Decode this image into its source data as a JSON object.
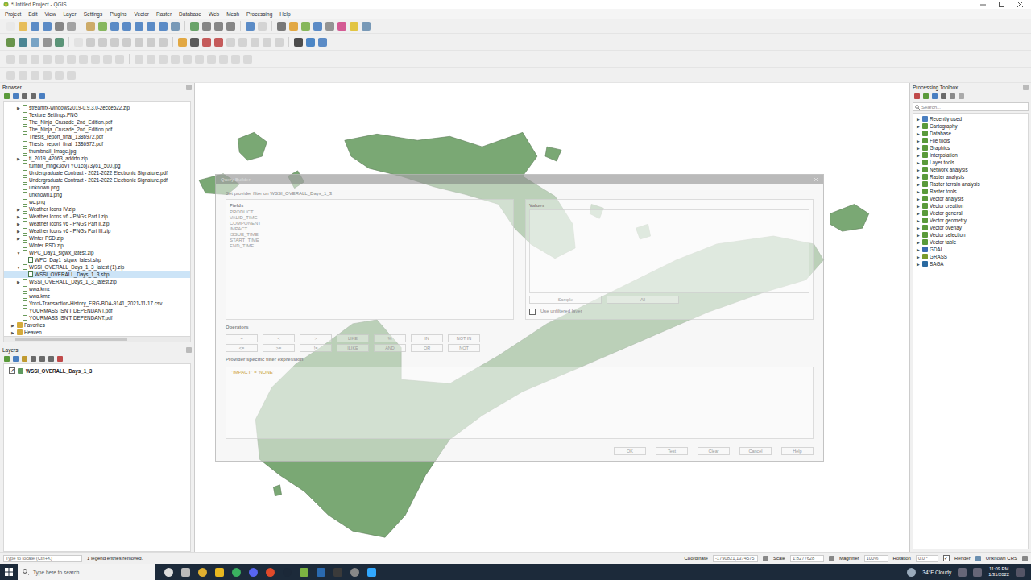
{
  "window": {
    "title": "*Untitled Project - QGIS"
  },
  "menu": [
    "Project",
    "Edit",
    "View",
    "Layer",
    "Settings",
    "Plugins",
    "Vector",
    "Raster",
    "Database",
    "Web",
    "Mesh",
    "Processing",
    "Help"
  ],
  "browser": {
    "title": "Browser",
    "items": [
      {
        "label": "streamfx-windows2019-0.9.3.0-2ecce522.zip",
        "kind": "zip",
        "depth": 1,
        "expanded": false,
        "selected": false
      },
      {
        "label": "Texture Settings.PNG",
        "kind": "file",
        "depth": 1,
        "selected": false
      },
      {
        "label": "The_Ninja_Crusade_2nd_Edition.pdf",
        "kind": "file",
        "depth": 1,
        "selected": false
      },
      {
        "label": "The_Ninja_Crusade_2nd_Edition.pdf",
        "kind": "file",
        "depth": 1,
        "selected": false
      },
      {
        "label": "Thesis_report_final_1386972.pdf",
        "kind": "file",
        "depth": 1,
        "selected": false
      },
      {
        "label": "Thesis_report_final_1386972.pdf",
        "kind": "file",
        "depth": 1,
        "selected": false
      },
      {
        "label": "thumbnail_Image.jpg",
        "kind": "file",
        "depth": 1,
        "selected": false
      },
      {
        "label": "tl_2019_42063_addrfn.zip",
        "kind": "zip",
        "depth": 1,
        "expanded": false,
        "selected": false
      },
      {
        "label": "tumblr_mngk3oVTYO1coj73yo1_500.jpg",
        "kind": "file",
        "depth": 1,
        "selected": false
      },
      {
        "label": "Undergraduate Contract - 2021-2022 Electronic Signature.pdf",
        "kind": "file",
        "depth": 1,
        "selected": false
      },
      {
        "label": "Undergraduate Contract - 2021-2022 Electronic Signature.pdf",
        "kind": "file",
        "depth": 1,
        "selected": false
      },
      {
        "label": "unknown.png",
        "kind": "file",
        "depth": 1,
        "selected": false
      },
      {
        "label": "unknown1.png",
        "kind": "file",
        "depth": 1,
        "selected": false
      },
      {
        "label": "wc.png",
        "kind": "file",
        "depth": 1,
        "selected": false
      },
      {
        "label": "Weather Icons IV.zip",
        "kind": "zip",
        "depth": 1,
        "expanded": false,
        "selected": false
      },
      {
        "label": "Weather Icons v6 - PNGs Part I.zip",
        "kind": "zip",
        "depth": 1,
        "expanded": false,
        "selected": false
      },
      {
        "label": "Weather Icons v6 - PNGs Part II.zip",
        "kind": "zip",
        "depth": 1,
        "expanded": false,
        "selected": false
      },
      {
        "label": "Weather Icons v6 - PNGs Part III.zip",
        "kind": "zip",
        "depth": 1,
        "expanded": false,
        "selected": false
      },
      {
        "label": "Winter PSD.zip",
        "kind": "zip",
        "depth": 1,
        "expanded": false,
        "selected": false
      },
      {
        "label": "Winter PSD.zip",
        "kind": "file",
        "depth": 1,
        "selected": false
      },
      {
        "label": "WPC_Day1_sigwx_latest.zip",
        "kind": "zip",
        "depth": 1,
        "expanded": true,
        "selected": false
      },
      {
        "label": "WPC_Day1_sigwx_latest.shp",
        "kind": "shp",
        "depth": 2,
        "selected": false
      },
      {
        "label": "WSSI_OVERALL_Days_1_3_latest (1).zip",
        "kind": "zip",
        "depth": 1,
        "expanded": true,
        "selected": false
      },
      {
        "label": "WSSI_OVERALL_Days_1_3.shp",
        "kind": "shp",
        "depth": 2,
        "selected": true
      },
      {
        "label": "WSSI_OVERALL_Days_1_3_latest.zip",
        "kind": "zip",
        "depth": 1,
        "expanded": false,
        "selected": false
      },
      {
        "label": "wwa.kmz",
        "kind": "file",
        "depth": 1,
        "selected": false
      },
      {
        "label": "wwa.kmz",
        "kind": "file",
        "depth": 1,
        "selected": false
      },
      {
        "label": "Yoroi-Transaction-History_ERG-BDA-9141_2021-11-17.csv",
        "kind": "file",
        "depth": 1,
        "selected": false
      },
      {
        "label": "YOURMASS ISN'T DEPENDANT.pdf",
        "kind": "file",
        "depth": 1,
        "selected": false
      },
      {
        "label": "YOURMASS ISN'T DEPENDANT.pdf",
        "kind": "file",
        "depth": 1,
        "selected": false
      },
      {
        "label": "Favorites",
        "kind": "folder",
        "depth": 0,
        "expanded": false,
        "selected": false
      },
      {
        "label": "Heaven",
        "kind": "folder",
        "depth": 0,
        "expanded": false,
        "selected": false
      }
    ]
  },
  "layers": {
    "title": "Layers",
    "items": [
      {
        "label": "WSSI_OVERALL_Days_1_3",
        "checked": true,
        "selected": false
      }
    ]
  },
  "processing": {
    "title": "Processing Toolbox",
    "search_placeholder": "Search...",
    "items": [
      {
        "label": "Recently used",
        "kind": "recent"
      },
      {
        "label": "Cartography",
        "kind": "qgis"
      },
      {
        "label": "Database",
        "kind": "qgis"
      },
      {
        "label": "File tools",
        "kind": "qgis"
      },
      {
        "label": "Graphics",
        "kind": "qgis"
      },
      {
        "label": "Interpolation",
        "kind": "qgis"
      },
      {
        "label": "Layer tools",
        "kind": "qgis"
      },
      {
        "label": "Network analysis",
        "kind": "qgis"
      },
      {
        "label": "Raster analysis",
        "kind": "qgis"
      },
      {
        "label": "Raster terrain analysis",
        "kind": "qgis"
      },
      {
        "label": "Raster tools",
        "kind": "qgis"
      },
      {
        "label": "Vector analysis",
        "kind": "qgis"
      },
      {
        "label": "Vector creation",
        "kind": "qgis"
      },
      {
        "label": "Vector general",
        "kind": "qgis"
      },
      {
        "label": "Vector geometry",
        "kind": "qgis"
      },
      {
        "label": "Vector overlay",
        "kind": "qgis"
      },
      {
        "label": "Vector selection",
        "kind": "qgis"
      },
      {
        "label": "Vector table",
        "kind": "qgis"
      },
      {
        "label": "GDAL",
        "kind": "gdal"
      },
      {
        "label": "GRASS",
        "kind": "grass"
      },
      {
        "label": "SAGA",
        "kind": "saga"
      }
    ]
  },
  "dialog": {
    "title": "Query Builder",
    "subtitle": "Set provider filter on WSSI_OVERALL_Days_1_3",
    "fields_label": "Fields",
    "fields": [
      "PRODUCT",
      "VALID_TIME",
      "COMPONENT",
      "IMPACT",
      "ISSUE_TIME",
      "START_TIME",
      "END_TIME"
    ],
    "values_label": "Values",
    "sample_button": "Sample",
    "all_button": "All",
    "unfiltered": {
      "label": "Use unfiltered layer",
      "checked": false
    },
    "operators_label": "Operators",
    "operators": [
      [
        "=",
        "<",
        ">",
        "LIKE",
        "%",
        "IN",
        "NOT IN"
      ],
      [
        "<=",
        ">=",
        "!=",
        "ILIKE",
        "AND",
        "OR",
        "NOT"
      ]
    ],
    "expression_label": "Provider specific filter expression",
    "expression": "\"IMPACT\" = 'NONE'",
    "buttons": [
      "OK",
      "Test",
      "Clear",
      "Cancel",
      "Help"
    ]
  },
  "status_bar": {
    "locator_placeholder": "Type to locate (Ctrl+K)",
    "message": "1 legend entries removed.",
    "coordinate_label": "Coordinate",
    "coordinate": "-1790821,1374575",
    "scale_label": "Scale",
    "scale": "1:8277628",
    "magnifier_label": "Magnifier",
    "magnifier": "100%",
    "rotation_label": "Rotation",
    "rotation": "0.0 °",
    "render_label": "Render",
    "render_checked": true,
    "crs": "Unknown CRS"
  },
  "taskbar": {
    "search_placeholder": "Type here to search",
    "weather": "34°F  Cloudy",
    "time": "11:09 PM",
    "date": "1/31/2022"
  }
}
